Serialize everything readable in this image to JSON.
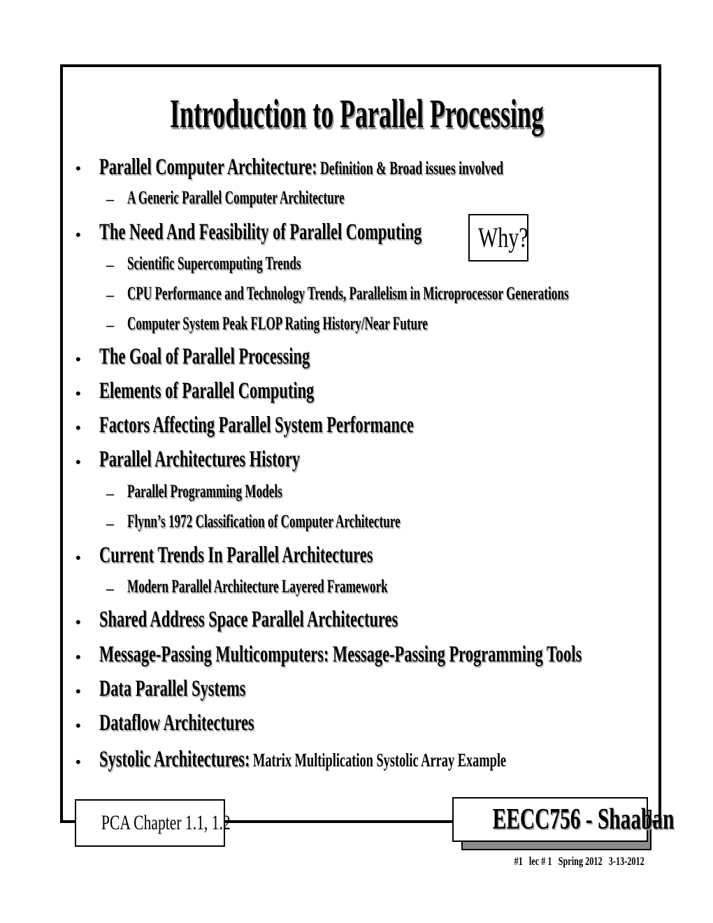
{
  "slide": {
    "title": "Introduction to Parallel Processing",
    "why_label": "Why?",
    "chapter_label": "PCA Chapter 1.1, 1.2",
    "course_label": "EECC756 - Shaaban",
    "footer": "#1   lec # 1   Spring 2012   3-13-2012",
    "bullet_glyph": "•",
    "dash_glyph": "–"
  },
  "outline": [
    {
      "text": "Parallel Computer Architecture:",
      "suffix": "  Definition & Broad issues involved",
      "sub": [
        "A Generic Parallel Computer Architecture"
      ]
    },
    {
      "text": "The Need And Feasibility of Parallel Computing",
      "sub": [
        "Scientific Supercomputing Trends",
        "CPU Performance and Technology Trends,  Parallelism in Microprocessor Generations",
        "Computer System Peak FLOP Rating History/Near Future"
      ]
    },
    {
      "text": "The Goal of Parallel Processing"
    },
    {
      "text": "Elements of Parallel Computing"
    },
    {
      "text": "Factors Affecting Parallel System Performance"
    },
    {
      "text": "Parallel Architectures History",
      "sub": [
        "Parallel Programming Models",
        "Flynn’s 1972 Classification of Computer Architecture"
      ]
    },
    {
      "text": "Current Trends In Parallel Architectures",
      "sub": [
        "Modern Parallel Architecture Layered Framework"
      ]
    },
    {
      "text": "Shared Address Space Parallel Architectures"
    },
    {
      "text": "Message-Passing Multicomputers: Message-Passing Programming Tools"
    },
    {
      "text": "Data Parallel Systems"
    },
    {
      "text": "Dataflow Architectures"
    },
    {
      "text": "Systolic Architectures:",
      "suffix": " Matrix Multiplication Systolic Array Example"
    }
  ]
}
